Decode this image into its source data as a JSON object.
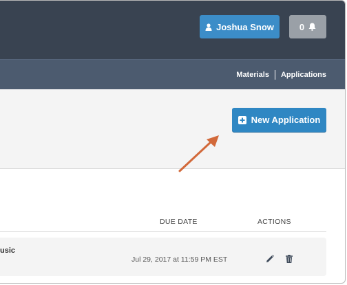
{
  "header": {
    "user_name": "Joshua Snow",
    "notification_count": "0"
  },
  "nav": {
    "items": [
      {
        "label": "Materials"
      },
      {
        "label": "Applications"
      }
    ]
  },
  "page": {
    "new_application_label": "New Application"
  },
  "table": {
    "columns": {
      "due_date": "DUE DATE",
      "actions": "ACTIONS"
    },
    "rows": [
      {
        "title": "usic",
        "due_date": "Jul 29, 2017 at 11:59 PM EST"
      }
    ]
  },
  "colors": {
    "topbar": "#394351",
    "navbar": "#4c5b6f",
    "primary_button": "#2f87c3",
    "notification_button": "#9aa0a7",
    "annotation_arrow": "#d2693a"
  }
}
